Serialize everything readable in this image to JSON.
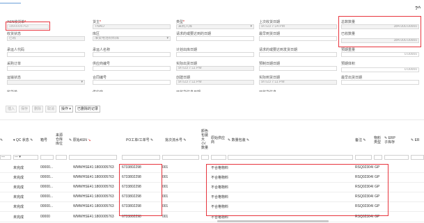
{
  "form": {
    "asn_label": "ASN收货单",
    "asn_value": "1800005763",
    "owner_label": "货主",
    "owner_value": "TNAO",
    "type_label": "类型",
    "type_value": "采购入库",
    "last_receipt_label": "上次收货日期",
    "last_receipt_value": "9/7/23 7:14 PM",
    "total_qty_label": "总数数量",
    "total_qty_value": "384.000.00000",
    "status_label": "收货状态",
    "status_value": "已收",
    "warehouse_label": "库区",
    "warehouse_value": "淮安电池材料库",
    "expected_date_label": "请求的或要达到的日期",
    "expected_date_value": "",
    "latest_arrival_label": "最早到货日期",
    "latest_arrival_value": "",
    "received_qty_label": "已收数量",
    "received_qty_value": "384.000.00000",
    "consignee_label": "承运人代码",
    "consignee_value": "",
    "carrier_name_label": "承运人名称",
    "carrier_name_value": "",
    "plan_ship_label": "计划出库日期",
    "plan_ship_value": "",
    "requested_ship_label": "请求的或要达到发货日期",
    "requested_ship_value": "",
    "expected_qty_label": "预期重量",
    "expected_qty_value": "0.00000",
    "purchase_order_label": "采购订单",
    "purchase_order_value": "",
    "supplier_code_label": "供应商编号",
    "supplier_code_value": "",
    "actual_arrival_label": "实际出货日期",
    "actual_arrival_value": "9/7/23 7:11 PM",
    "preset_label": "预制日期日期",
    "preset_value": "",
    "expected_volume_label": "预期体积",
    "expected_volume_value": "0.00000",
    "origin_status_label": "运输状态",
    "origin_status_value": "",
    "contract_label": "合同编号",
    "contract_value": "",
    "create_date_label": "创建日期",
    "create_date_value": "9/7/23 7:11 PM",
    "actual_receipt_label": "实际到货日期",
    "actual_receipt_value": "9/7/23 7:11 PM",
    "latest_ship_label": "最早出货日期",
    "latest_ship_value": "",
    "cut1": "收货单",
    "cut2": "供应商",
    "cut3": "已收货信息日期",
    "cut4": "已收货信息"
  },
  "toolbar": {
    "insert": "插入",
    "save": "保存",
    "delete": "删除",
    "cancel": "取消",
    "operations": "操作",
    "receive_record": "已删除的记录"
  },
  "grid": {
    "headers": {
      "qc_status": "QC 状态",
      "line_no": "箱号",
      "origin_warehouse": "来源仓库库位",
      "origin_asn": "原始ASN",
      "po_line": "PO工单/工单号",
      "batch_line": "批次流水号",
      "color": "颜色包装大小/数量",
      "raw_material": "原始供应商",
      "qty_bar": "数量包装",
      "remark": "备注",
      "material_type": "物料类型",
      "erp_sub": "ERP子库存",
      "extra": "ER"
    },
    "filters": {
      "f1": "---",
      "f2": "---"
    },
    "rows": [
      {
        "qc": "未完成",
        "line": "00000...",
        "asn": "WMWHSE41:1800005763",
        "po": "6733802298",
        "batch": "001",
        "raw": "不合格物料",
        "remark": "RSQ02304857",
        "mtype": "GP"
      },
      {
        "qc": "未完成",
        "line": "00000...",
        "asn": "WMWHSE41:1800005763",
        "po": "6733802298",
        "batch": "001",
        "raw": "不合格物料",
        "remark": "RSQ02304857",
        "mtype": "GP"
      },
      {
        "qc": "未完成",
        "line": "00000...",
        "asn": "WMWHSE41:1800005763",
        "po": "6733802298",
        "batch": "001",
        "raw": "不合格物料",
        "remark": "RSQ02304857",
        "mtype": "GP"
      },
      {
        "qc": "未完成",
        "line": "00000...",
        "asn": "WMWHSE41:1800005763",
        "po": "6733802298",
        "batch": "001",
        "raw": "不合格物料",
        "remark": "RSQ02304857",
        "mtype": "GP"
      },
      {
        "qc": "未完成",
        "line": "00000...",
        "asn": "WMWHSE41:1800005763",
        "po": "6733802298",
        "batch": "001",
        "raw": "不合格物料",
        "remark": "RSQ02304857",
        "mtype": "GP"
      },
      {
        "qc": "未完成",
        "line": "00000",
        "asn": "WMWHSE41:1800005763",
        "po": "6733802298",
        "batch": "001",
        "raw": "不合格物料",
        "remark": "RSQ02304857",
        "mtype": "GP"
      }
    ]
  }
}
